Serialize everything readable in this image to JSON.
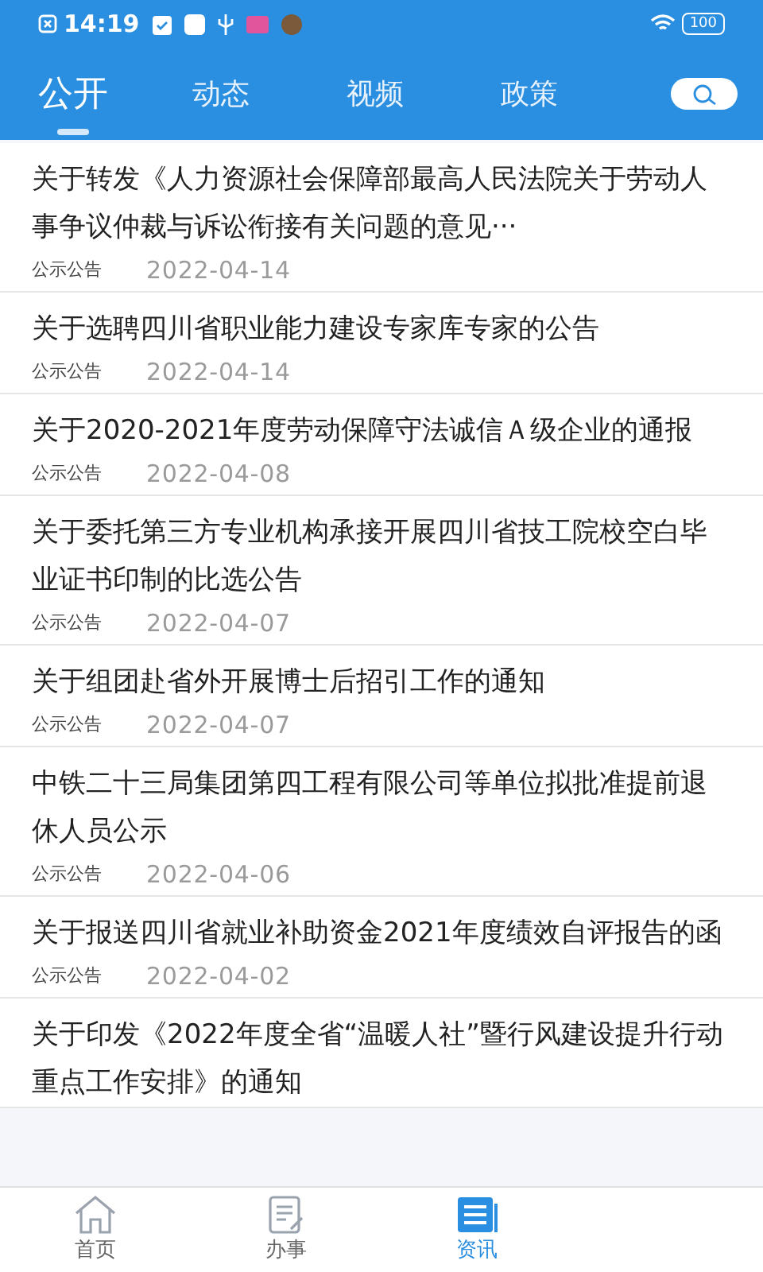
{
  "status_bar": {
    "time": "14:19",
    "battery": "100"
  },
  "tabs": [
    {
      "label": "公开",
      "selected": true
    },
    {
      "label": "动态",
      "selected": false
    },
    {
      "label": "视频",
      "selected": false
    },
    {
      "label": "政策",
      "selected": false
    }
  ],
  "articles": [
    {
      "title": "关于转发《人力资源社会保障部最高人民法院关于劳动人事争议仲裁与诉讼衔接有关问题的意见···",
      "category": "公示公告",
      "date": "2022-04-14"
    },
    {
      "title": "关于选聘四川省职业能力建设专家库专家的公告",
      "category": "公示公告",
      "date": "2022-04-14"
    },
    {
      "title": "关于2020-2021年度劳动保障守法诚信Ａ级企业的通报",
      "category": "公示公告",
      "date": "2022-04-08"
    },
    {
      "title": "关于委托第三方专业机构承接开展四川省技工院校空白毕业证书印制的比选公告",
      "category": "公示公告",
      "date": "2022-04-07"
    },
    {
      "title": "关于组团赴省外开展博士后招引工作的通知",
      "category": "公示公告",
      "date": "2022-04-07"
    },
    {
      "title": "中铁二十三局集团第四工程有限公司等单位拟批准提前退休人员公示",
      "category": "公示公告",
      "date": "2022-04-06"
    },
    {
      "title": "关于报送四川省就业补助资金2021年度绩效自评报告的函",
      "category": "公示公告",
      "date": "2022-04-02"
    },
    {
      "title": "关于印发《2022年度全省“温暖人社”暨行风建设提升行动重点工作安排》的通知"
    }
  ],
  "bottom_nav": [
    {
      "label": "首页",
      "kind": "home",
      "selected": false
    },
    {
      "label": "办事",
      "kind": "form",
      "selected": false
    },
    {
      "label": "资讯",
      "kind": "news",
      "selected": true
    }
  ]
}
